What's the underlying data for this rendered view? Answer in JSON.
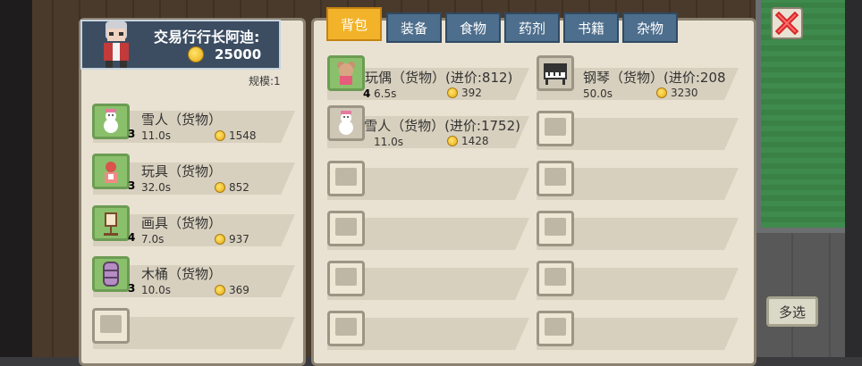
{
  "merchant": {
    "name": "交易行行长阿迪:",
    "gold": "25000",
    "scale": "规模:1"
  },
  "tabs": [
    {
      "label": "背包",
      "active": true
    },
    {
      "label": "装备"
    },
    {
      "label": "食物"
    },
    {
      "label": "药剂"
    },
    {
      "label": "书籍"
    },
    {
      "label": "杂物"
    }
  ],
  "shop_items": [
    {
      "name": "雪人（货物）",
      "time": "11.0s",
      "price": "1548",
      "count": "3",
      "icon": "snowman-icon"
    },
    {
      "name": "玩具（货物）",
      "time": "32.0s",
      "price": "852",
      "count": "3",
      "icon": "toy-icon"
    },
    {
      "name": "画具（货物）",
      "time": "7.0s",
      "price": "937",
      "count": "4",
      "icon": "easel-icon"
    },
    {
      "name": "木桶（货物）",
      "time": "10.0s",
      "price": "369",
      "count": "3",
      "icon": "barrel-icon"
    }
  ],
  "bag_items": [
    {
      "name": "玩偶（货物）(进价:812)",
      "time": "6.5s",
      "price": "392",
      "count": "4",
      "icon": "doll-icon"
    },
    {
      "name": "钢琴（货物）(进价:208",
      "time": "50.0s",
      "price": "3230",
      "count": "",
      "icon": "piano-icon"
    },
    {
      "name": "雪人（货物）(进价:1752)",
      "time": "11.0s",
      "price": "1428",
      "count": "",
      "icon": "snowman-icon"
    }
  ],
  "buttons": {
    "multi_select": "多选"
  }
}
